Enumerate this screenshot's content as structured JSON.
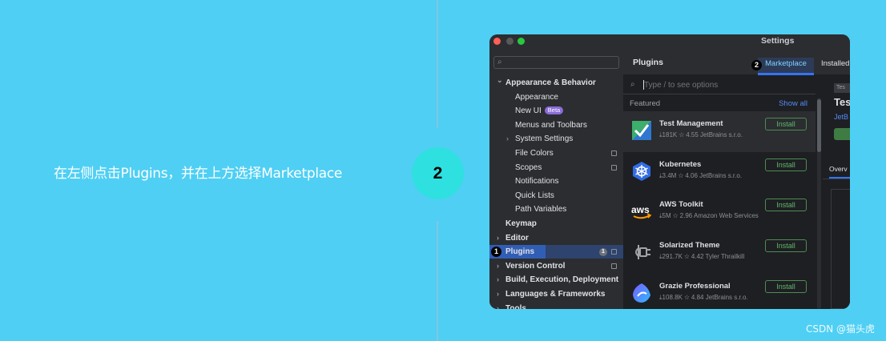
{
  "instruction": {
    "text": "在左侧点击Plugins，并在上方选择Marketplace"
  },
  "step": {
    "number": "2"
  },
  "watermark": "CSDN @猫头虎",
  "window": {
    "title": "Settings",
    "traffic_lights": [
      "close",
      "minimize",
      "maximize"
    ]
  },
  "sidebar": {
    "search_placeholder": "",
    "items": [
      {
        "label": "Appearance & Behavior",
        "level": 0,
        "chevron": "down",
        "bold": true
      },
      {
        "label": "Appearance",
        "level": 1
      },
      {
        "label": "New UI",
        "level": 1,
        "badge": "Beta"
      },
      {
        "label": "Menus and Toolbars",
        "level": 1
      },
      {
        "label": "System Settings",
        "level": 1,
        "chevron": "right"
      },
      {
        "label": "File Colors",
        "level": 1,
        "icon": true
      },
      {
        "label": "Scopes",
        "level": 1,
        "icon": true
      },
      {
        "label": "Notifications",
        "level": 1
      },
      {
        "label": "Quick Lists",
        "level": 1
      },
      {
        "label": "Path Variables",
        "level": 1
      },
      {
        "label": "Keymap",
        "level": 0,
        "bold": true
      },
      {
        "label": "Editor",
        "level": 0,
        "chevron": "right",
        "bold": true
      },
      {
        "label": "Plugins",
        "level": 0,
        "bold": true,
        "selected": true,
        "count": "1",
        "icon": true
      },
      {
        "label": "Version Control",
        "level": 0,
        "chevron": "right",
        "bold": true,
        "icon": true
      },
      {
        "label": "Build, Execution, Deployment",
        "level": 0,
        "chevron": "right",
        "bold": true
      },
      {
        "label": "Languages & Frameworks",
        "level": 0,
        "chevron": "right",
        "bold": true
      },
      {
        "label": "Tools",
        "level": 0,
        "chevron": "right",
        "bold": true
      }
    ]
  },
  "markers": {
    "plugins": "1",
    "marketplace": "2"
  },
  "plugins_panel": {
    "title": "Plugins",
    "tabs": {
      "marketplace": "Marketplace",
      "installed": "Installed"
    },
    "search_placeholder": "Type / to see options",
    "featured_label": "Featured",
    "show_all": "Show all",
    "install_label": "Install",
    "plugins": [
      {
        "name": "Test Management",
        "downloads": "181K",
        "rating": "4.55",
        "vendor": "JetBrains s.r.o.",
        "icon": "test-management-icon",
        "active": true
      },
      {
        "name": "Kubernetes",
        "downloads": "3.4M",
        "rating": "4.06",
        "vendor": "JetBrains s.r.o.",
        "icon": "kubernetes-icon"
      },
      {
        "name": "AWS Toolkit",
        "downloads": "5M",
        "rating": "2.96",
        "vendor": "Amazon Web Services",
        "icon": "aws-icon"
      },
      {
        "name": "Solarized Theme",
        "downloads": "291.7K",
        "rating": "4.42",
        "vendor": "Tyler Thrailkill",
        "icon": "plug-icon"
      },
      {
        "name": "Grazie Professional",
        "downloads": "108.8K",
        "rating": "4.84",
        "vendor": "JetBrains s.r.o.",
        "icon": "grazie-icon"
      }
    ]
  },
  "detail": {
    "tag": "Tes",
    "title": "Tes",
    "vendor": "JetB",
    "tab": "Overv"
  },
  "colors": {
    "background": "#4fcff4",
    "step_circle": "#2fe0e0",
    "accent_blue": "#3574f0",
    "install_green": "#5fb86b"
  }
}
